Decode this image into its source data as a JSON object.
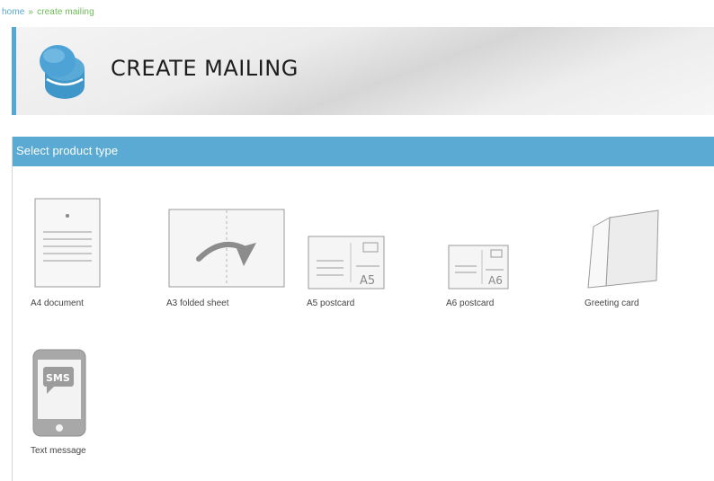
{
  "breadcrumb": {
    "home": "home",
    "separator": "»",
    "current": "create mailing"
  },
  "header": {
    "title": "CREATE MAILING",
    "logo_icon": "stacked-coins-icon",
    "accent_color": "#55a8d2"
  },
  "panel": {
    "title": "Select product type",
    "header_color": "#5aaad3"
  },
  "products": [
    {
      "label": "A4 document",
      "icon": "a4-document-icon"
    },
    {
      "label": "A3 folded sheet",
      "icon": "a3-folded-sheet-icon"
    },
    {
      "label": "A5 postcard",
      "icon": "a5-postcard-icon",
      "size_text": "A5"
    },
    {
      "label": "A6 postcard",
      "icon": "a6-postcard-icon",
      "size_text": "A6"
    },
    {
      "label": "Greeting card",
      "icon": "greeting-card-icon"
    },
    {
      "label": "Text message",
      "icon": "text-message-icon",
      "badge_text": "SMS"
    }
  ]
}
